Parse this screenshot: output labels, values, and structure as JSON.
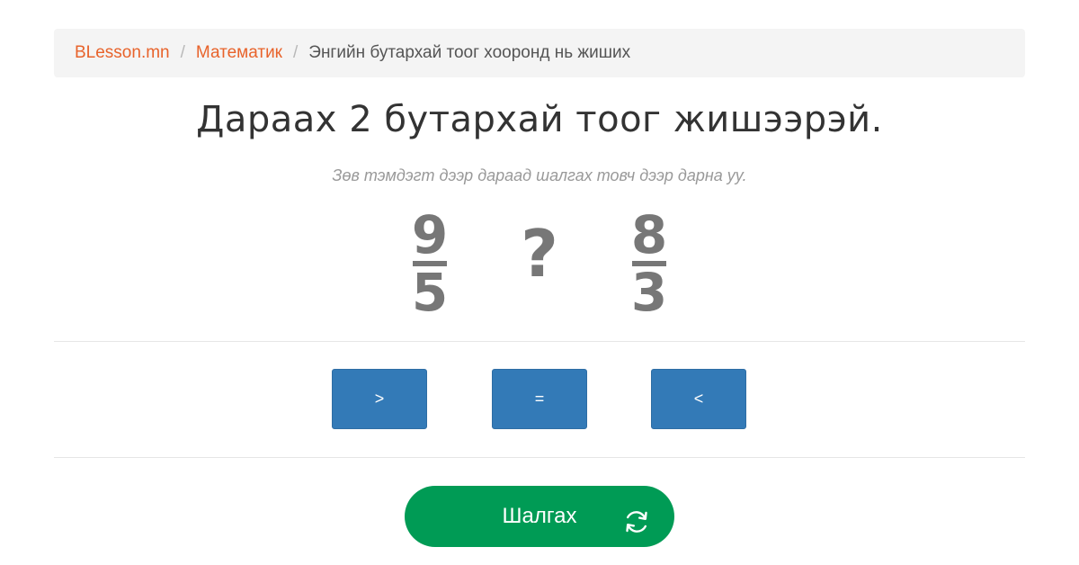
{
  "breadcrumb": {
    "home": "BLesson.mn",
    "category": "Математик",
    "current": "Энгийн бутархай тоог хооронд нь жиших",
    "separator": "/"
  },
  "title": "Дараах 2 бутархай тоог жишээрэй.",
  "instruction": "Зөв тэмдэгт дээр дараад шалгах товч дээр дарна уу.",
  "exercise": {
    "left_fraction": {
      "numerator": "9",
      "denominator": "5"
    },
    "comparison_symbol": "?",
    "right_fraction": {
      "numerator": "8",
      "denominator": "3"
    }
  },
  "options": {
    "greater": ">",
    "equal": "=",
    "less": "<"
  },
  "check_button": {
    "label": "Шалгах",
    "icon": "refresh-icon"
  },
  "colors": {
    "link": "#e8632b",
    "option_button": "#337ab7",
    "check_button": "#009b55",
    "fraction_text": "#777777"
  }
}
